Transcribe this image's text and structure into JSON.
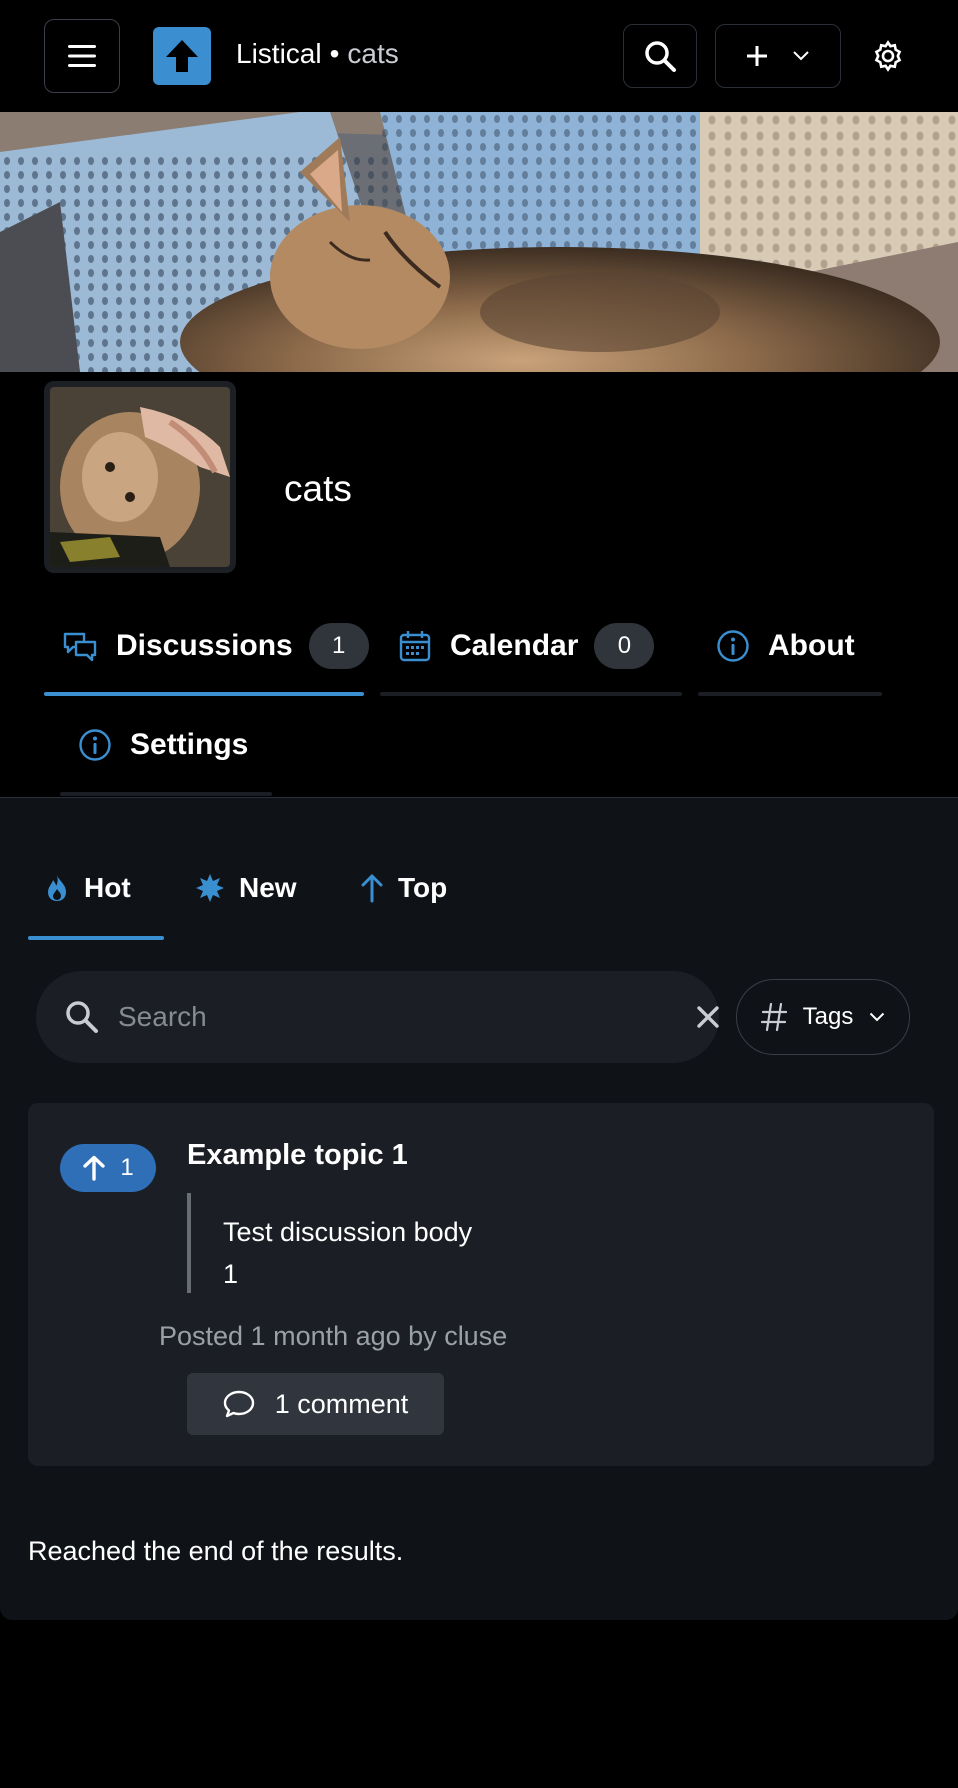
{
  "header": {
    "app_name": "Listical",
    "separator": "•",
    "community": "cats"
  },
  "community": {
    "name": "cats"
  },
  "tabs": [
    {
      "label": "Discussions",
      "count": "1",
      "active": true
    },
    {
      "label": "Calendar",
      "count": "0",
      "active": false
    },
    {
      "label": "About",
      "active": false
    },
    {
      "label": "Settings",
      "active": false
    }
  ],
  "sort": {
    "options": [
      {
        "label": "Hot",
        "active": true
      },
      {
        "label": "New",
        "active": false
      },
      {
        "label": "Top",
        "active": false
      }
    ]
  },
  "search": {
    "placeholder": "Search",
    "value": ""
  },
  "tags_filter": {
    "label": "Tags"
  },
  "posts": [
    {
      "score": "1",
      "title": "Example topic 1",
      "body": "Test discussion body 1",
      "meta": "Posted 1 month ago by cluse",
      "comments_label": "1 comment"
    }
  ],
  "end_message": "Reached the end of the results.",
  "colors": {
    "accent": "#3a8fd0",
    "vote": "#2f6fb8",
    "background": "#000000",
    "panel": "#0f1217",
    "card": "#1b1e25"
  }
}
